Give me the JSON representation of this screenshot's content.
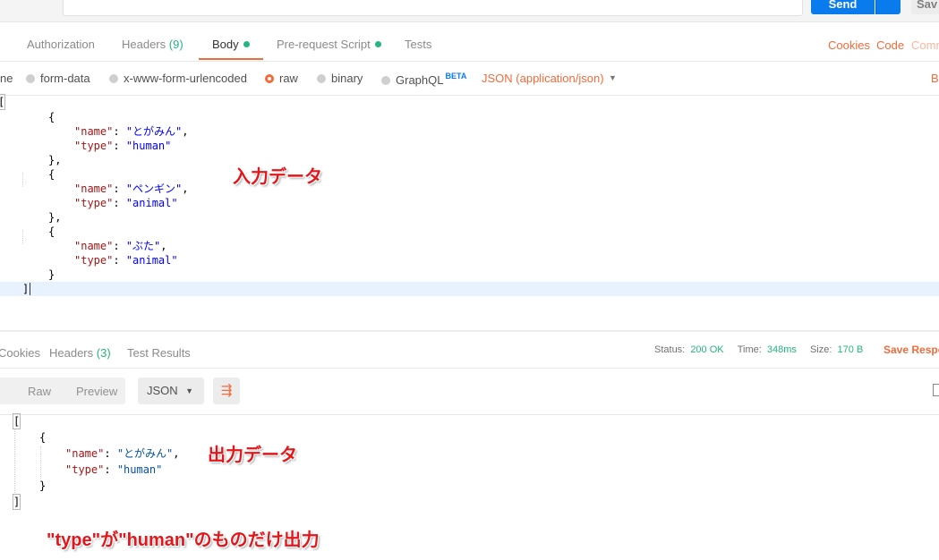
{
  "request_bar": {
    "send_label": "Send",
    "save_label": "Sav"
  },
  "request_tabs": {
    "authorization": "Authorization",
    "headers": "Headers",
    "headers_count": "(9)",
    "body": "Body",
    "prerequest": "Pre-request Script",
    "tests": "Tests",
    "cookies": "Cookies",
    "code": "Code",
    "comments": "Comm"
  },
  "body_types": {
    "none": "ne",
    "form_data": "form-data",
    "urlencoded": "x-www-form-urlencoded",
    "raw": "raw",
    "binary": "binary",
    "graphql": "GraphQL",
    "beta": "BETA",
    "content_type": "JSON (application/json)",
    "beautify": "B"
  },
  "request_code": {
    "open_bracket": "[",
    "close_bracket": "]",
    "items": [
      {
        "name_key": "\"name\"",
        "name_val": "\"とがみん\"",
        "type_key": "\"type\"",
        "type_val": "\"human\""
      },
      {
        "name_key": "\"name\"",
        "name_val": "\"ペンギン\"",
        "type_key": "\"type\"",
        "type_val": "\"animal\""
      },
      {
        "name_key": "\"name\"",
        "name_val": "\"ぶた\"",
        "type_key": "\"type\"",
        "type_val": "\"animal\""
      }
    ]
  },
  "response_tabs": {
    "cookies": "Cookies",
    "headers": "Headers",
    "headers_count": "(3)",
    "test_results": "Test Results",
    "status_label": "Status:",
    "status_value": "200 OK",
    "time_label": "Time:",
    "time_value": "348ms",
    "size_label": "Size:",
    "size_value": "170 B",
    "save_response": "Save Respo"
  },
  "response_toolbar": {
    "raw": "Raw",
    "preview": "Preview",
    "format": "JSON"
  },
  "response_code": {
    "open_bracket": "[",
    "close_bracket": "]",
    "name_key": "\"name\"",
    "name_val": "\"とがみん\"",
    "type_key": "\"type\"",
    "type_val": "\"human\""
  },
  "annotations": {
    "input_label": "入力データ",
    "output_label": "出力データ",
    "caption": "\"type\"が\"human\"のものだけ出力"
  },
  "colors": {
    "accent": "#f26b3a",
    "send": "#097bed",
    "success": "#26b47f",
    "annotation": "#e3171b"
  }
}
